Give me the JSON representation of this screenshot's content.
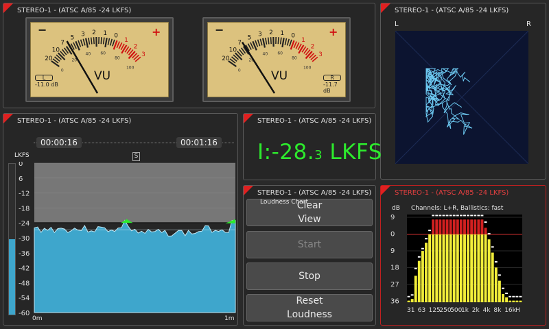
{
  "panel_title": "STEREO-1 - (ATSC A/85 -24 LKFS)",
  "vu_left": {
    "minus": "−",
    "plus": "+",
    "scale_top": [
      "20",
      "10",
      "7",
      "5",
      "3",
      "2",
      "1",
      "0",
      "1",
      "2",
      "3"
    ],
    "scale_pct": [
      "0",
      "20",
      "40",
      "60",
      "80",
      "100"
    ],
    "label": "VU",
    "channel": "L",
    "db": "-11.0 dB",
    "needle_vu": -11.0
  },
  "vu_right": {
    "minus": "−",
    "plus": "+",
    "scale_top": [
      "20",
      "10",
      "7",
      "5",
      "3",
      "2",
      "1",
      "0",
      "1",
      "2",
      "3"
    ],
    "scale_pct": [
      "0",
      "20",
      "40",
      "60",
      "80",
      "100"
    ],
    "label": "VU",
    "channel": "R",
    "db": "-11.7 dB",
    "needle_vu": -11.7
  },
  "goniometer": {
    "left_label": "L",
    "right_label": "R"
  },
  "history": {
    "time_start": "00:00:16",
    "time_end": "00:01:16",
    "badge": "S",
    "axis_unit": "LKFS",
    "y_ticks": [
      "0",
      "6",
      "-12",
      "-18",
      "-24",
      "-30",
      "-36",
      "-42",
      "-48",
      "-54",
      "-60"
    ],
    "x_start": "0m",
    "x_end": "1m",
    "bar_level": -30
  },
  "integrated": {
    "prefix": "I:",
    "value_main": "-28.",
    "value_dec": "3",
    "unit": " LKFS"
  },
  "controls": {
    "chart_label": "Loudness Chart",
    "clear_line1": "Clear",
    "clear_line2": "View",
    "start": "Start",
    "stop": "Stop",
    "reset_line1": "Reset",
    "reset_line2": "Loudness"
  },
  "rta": {
    "db_label": "dB",
    "info": "Channels: L+R, Ballistics: fast",
    "y_ticks": [
      "9",
      "0",
      "9",
      "18",
      "27",
      "36"
    ],
    "x_ticks": [
      "31",
      "63",
      "125",
      "250",
      "500",
      "1k",
      "2k",
      "4k",
      "8k",
      "16k",
      "H"
    ]
  },
  "colors": {
    "accent_red": "#e02020",
    "loudness_green": "#2dea2d",
    "history_fill": "#3ea6cc",
    "rta_yellow": "#f2ee3a",
    "rta_red": "#d22020",
    "trace_blue": "#6cc8f0"
  },
  "chart_data": {
    "type": "bar",
    "title": "Channels: L+R, Ballistics: fast",
    "ylabel": "dB",
    "categories": [
      "31",
      "63",
      "125",
      "250",
      "500",
      "1k",
      "2k",
      "4k",
      "8k",
      "16k",
      "H"
    ],
    "series": [
      {
        "name": "L+R",
        "values": [
          40,
          39,
          25,
          16,
          10,
          5,
          0,
          -9,
          -9,
          -9,
          -9,
          -9,
          -9,
          -9,
          -9,
          -9,
          -9,
          -9,
          -9,
          -9,
          -9,
          -9,
          -4,
          3,
          11,
          20,
          28,
          36,
          38,
          40,
          40,
          40,
          40
        ]
      }
    ],
    "peaks": [
      38,
      37,
      21,
      14,
      9,
      3,
      -2,
      -11,
      -11,
      -11,
      -11,
      -11,
      -11,
      -11,
      -11,
      -11,
      -11,
      -11,
      -11,
      -11,
      -11,
      -11,
      -7,
      0,
      8,
      17,
      25,
      33,
      36,
      38,
      38,
      38,
      38
    ],
    "ylim": [
      41,
      -12
    ]
  }
}
